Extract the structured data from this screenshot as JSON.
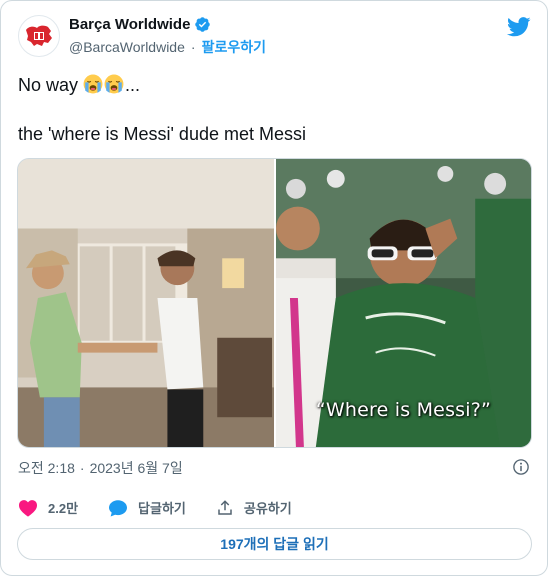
{
  "account": {
    "display_name": "Barça Worldwide",
    "handle": "@BarcaWorldwide",
    "separator": "·",
    "follow_label": "팔로우하기"
  },
  "tweet": {
    "line1_text": "No way ",
    "line1_suffix": "...",
    "emoji": [
      "loudly-crying-face-emoji",
      "loudly-crying-face-emoji"
    ],
    "line2_text": "the 'where is Messi' dude met Messi"
  },
  "media": {
    "right_caption": "“Where is Messi?”"
  },
  "meta": {
    "time": "오전 2:18",
    "separator": "·",
    "date": "2023년 6월 7일"
  },
  "actions": {
    "likes_count": "2.2만",
    "reply_label": "답글하기",
    "share_label": "공유하기"
  },
  "read_replies_label": "197개의 답글 읽기",
  "colors": {
    "accent": "#1d9bf0",
    "like": "#f91880",
    "text_secondary": "#536471",
    "border": "#cfd9de"
  }
}
